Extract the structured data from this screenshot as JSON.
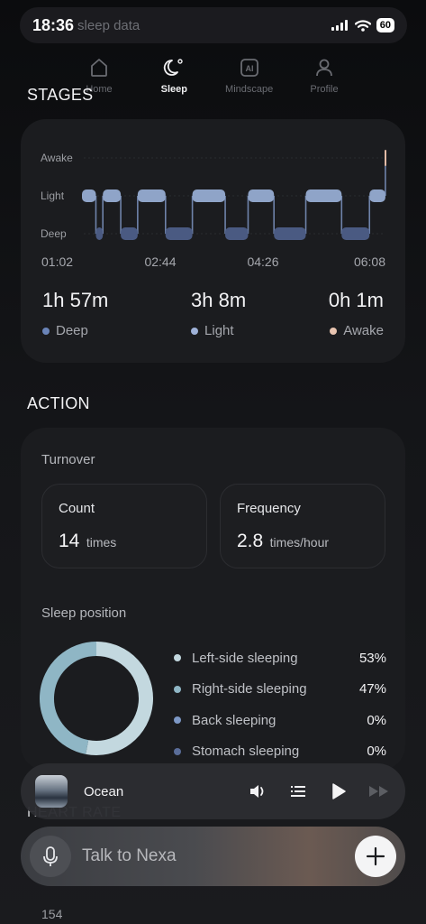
{
  "status_bar": {
    "time": "18:36",
    "subtitle": "sleep data",
    "battery": "60"
  },
  "nav": {
    "items": [
      {
        "label": "Home"
      },
      {
        "label": "Sleep"
      },
      {
        "label": "Mindscape"
      },
      {
        "label": "Profile"
      }
    ],
    "active": "Sleep"
  },
  "stages": {
    "title": "STAGES",
    "chart_data": {
      "type": "line",
      "title": "",
      "y_levels": [
        "Awake",
        "Light",
        "Deep"
      ],
      "x_tick_labels": [
        "01:02",
        "02:44",
        "04:26",
        "06:08"
      ],
      "x_range": [
        "01:02",
        "06:08"
      ],
      "segments": [
        {
          "stage": "Light",
          "start": "01:02",
          "end": "01:16"
        },
        {
          "stage": "Deep",
          "start": "01:16",
          "end": "01:23"
        },
        {
          "stage": "Light",
          "start": "01:23",
          "end": "01:41"
        },
        {
          "stage": "Deep",
          "start": "01:41",
          "end": "01:58"
        },
        {
          "stage": "Light",
          "start": "01:58",
          "end": "02:26"
        },
        {
          "stage": "Deep",
          "start": "02:26",
          "end": "02:53"
        },
        {
          "stage": "Light",
          "start": "02:53",
          "end": "03:26"
        },
        {
          "stage": "Deep",
          "start": "03:26",
          "end": "03:49"
        },
        {
          "stage": "Light",
          "start": "03:49",
          "end": "04:15"
        },
        {
          "stage": "Deep",
          "start": "04:15",
          "end": "04:47"
        },
        {
          "stage": "Light",
          "start": "04:47",
          "end": "05:23"
        },
        {
          "stage": "Deep",
          "start": "05:23",
          "end": "05:51"
        },
        {
          "stage": "Light",
          "start": "05:51",
          "end": "06:07"
        },
        {
          "stage": "Awake",
          "start": "06:07",
          "end": "06:08"
        }
      ],
      "colors": {
        "Light": "#8fa4c8",
        "Deep": "#4a5a82",
        "Awake": "#e3bba6"
      }
    },
    "summary": [
      {
        "value": "1h 57m",
        "label": "Deep",
        "color": "#6a84b8"
      },
      {
        "value": "3h 8m",
        "label": "Light",
        "color": "#9fb2d8"
      },
      {
        "value": "0h 1m",
        "label": "Awake",
        "color": "#e8c4b0"
      }
    ]
  },
  "action": {
    "title": "ACTION",
    "turnover": {
      "label": "Turnover",
      "count": {
        "title": "Count",
        "value": "14",
        "unit": "times"
      },
      "frequency": {
        "title": "Frequency",
        "value": "2.8",
        "unit": "times/hour"
      }
    },
    "sleep_position": {
      "label": "Sleep position",
      "items": [
        {
          "label": "Left-side sleeping",
          "percent": "53%",
          "value": 53,
          "color": "#c3d8df"
        },
        {
          "label": "Right-side sleeping",
          "percent": "47%",
          "value": 47,
          "color": "#8fb6c5"
        },
        {
          "label": "Back sleeping",
          "percent": "0%",
          "value": 0,
          "color": "#7d98c6"
        },
        {
          "label": "Stomach sleeping",
          "percent": "0%",
          "value": 0,
          "color": "#5a6d99"
        }
      ]
    }
  },
  "player": {
    "track": "Ocean"
  },
  "heart_rate": {
    "title": "HEART RATE",
    "value": "154"
  },
  "assistant": {
    "placeholder": "Talk to Nexa"
  }
}
